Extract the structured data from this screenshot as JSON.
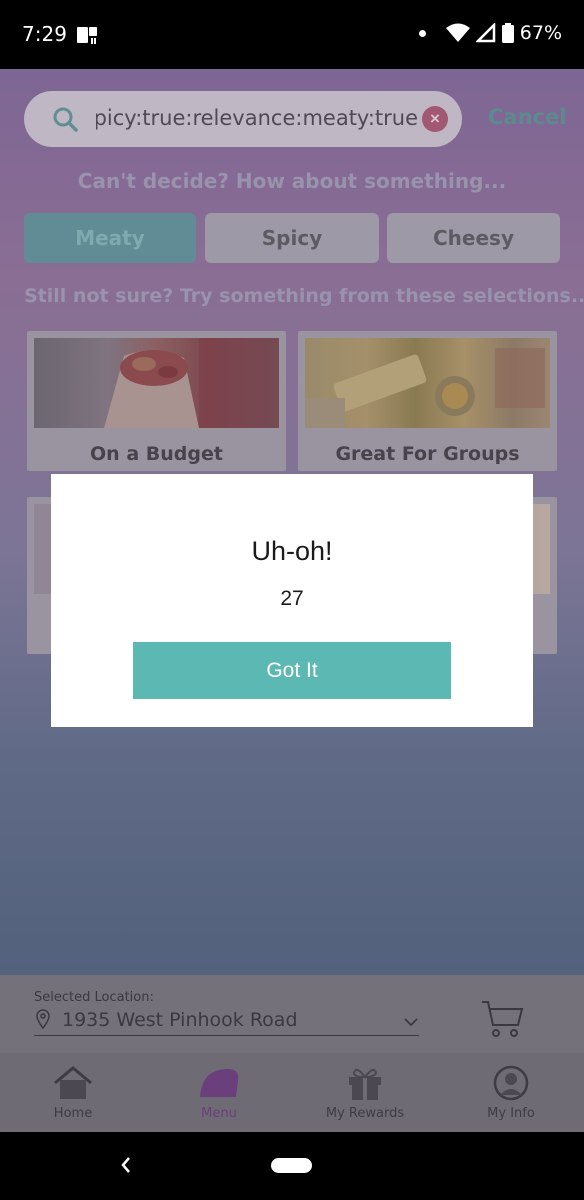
{
  "status_bar": {
    "time": "7:29",
    "battery": "67%",
    "icons": [
      "notification-icon",
      "wifi-icon",
      "signal-icon",
      "battery-icon"
    ]
  },
  "search": {
    "value": "spicy:true:relevance:meaty:true",
    "cancel_label": "Cancel"
  },
  "suggestions": {
    "prompt": "Can't decide? How about something...",
    "choices": [
      "Meaty",
      "Spicy",
      "Cheesy"
    ],
    "selected": "Meaty"
  },
  "selections": {
    "prompt": "Still not sure? Try something from these selections...",
    "cards": [
      {
        "title": "On a Budget"
      },
      {
        "title": "Great For Groups"
      }
    ]
  },
  "location": {
    "label": "Selected Location:",
    "value": "1935 West Pinhook Road"
  },
  "bottom_nav": {
    "items": [
      {
        "label": "Home",
        "icon": "home-icon"
      },
      {
        "label": "Menu",
        "icon": "taco-icon"
      },
      {
        "label": "My Rewards",
        "icon": "gift-icon"
      },
      {
        "label": "My Info",
        "icon": "user-icon"
      }
    ],
    "active": "Menu"
  },
  "dialog": {
    "title": "Uh-oh!",
    "message": "27",
    "button_label": "Got It"
  },
  "colors": {
    "accent_teal": "#5cb8b2",
    "menu_active": "#6a3f7c"
  }
}
